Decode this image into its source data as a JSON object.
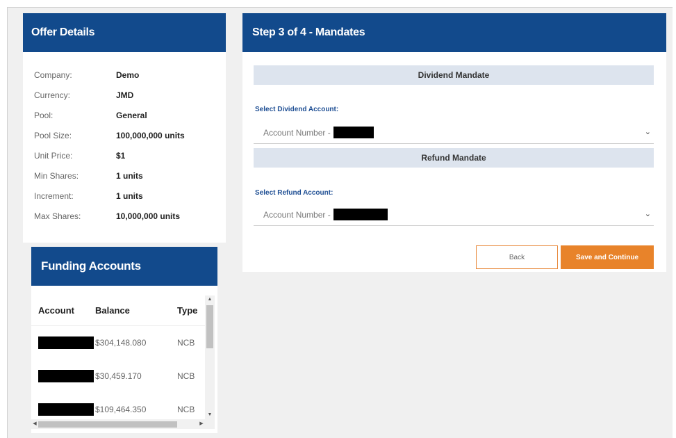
{
  "offer_details": {
    "title": "Offer Details",
    "rows": [
      {
        "label": "Company:",
        "value": "Demo"
      },
      {
        "label": "Currency:",
        "value": "JMD"
      },
      {
        "label": "Pool:",
        "value": "General"
      },
      {
        "label": "Pool Size:",
        "value": "100,000,000 units"
      },
      {
        "label": "Unit Price:",
        "value": "$1"
      },
      {
        "label": "Min Shares:",
        "value": "1 units"
      },
      {
        "label": "Increment:",
        "value": "1 units"
      },
      {
        "label": "Max Shares:",
        "value": "10,000,000 units"
      }
    ]
  },
  "funding_accounts": {
    "title": "Funding Accounts",
    "columns": [
      "Account",
      "Balance",
      "Type"
    ],
    "rows": [
      {
        "balance": "$304,148.080",
        "type": "NCB"
      },
      {
        "balance": "$30,459.170",
        "type": "NCB"
      },
      {
        "balance": "$109,464.350",
        "type": "NCB"
      }
    ]
  },
  "mandates": {
    "title": "Step 3 of 4 - Mandates",
    "dividend_section": "Dividend Mandate",
    "dividend_label": "Select Dividend Account:",
    "dividend_value": "Account Number -",
    "refund_section": "Refund Mandate",
    "refund_label": "Select Refund Account:",
    "refund_value": "Account Number -",
    "back_label": "Back",
    "save_label": "Save and Continue"
  },
  "icons": {
    "dropdown": "chevron-down-icon",
    "scroll_up": "arrow-up-icon",
    "scroll_down": "arrow-down-icon"
  },
  "colors": {
    "header_blue": "#124a8c",
    "accent_orange": "#e8832a",
    "section_bar": "#dde4ee",
    "label_blue": "#1f4f94"
  }
}
